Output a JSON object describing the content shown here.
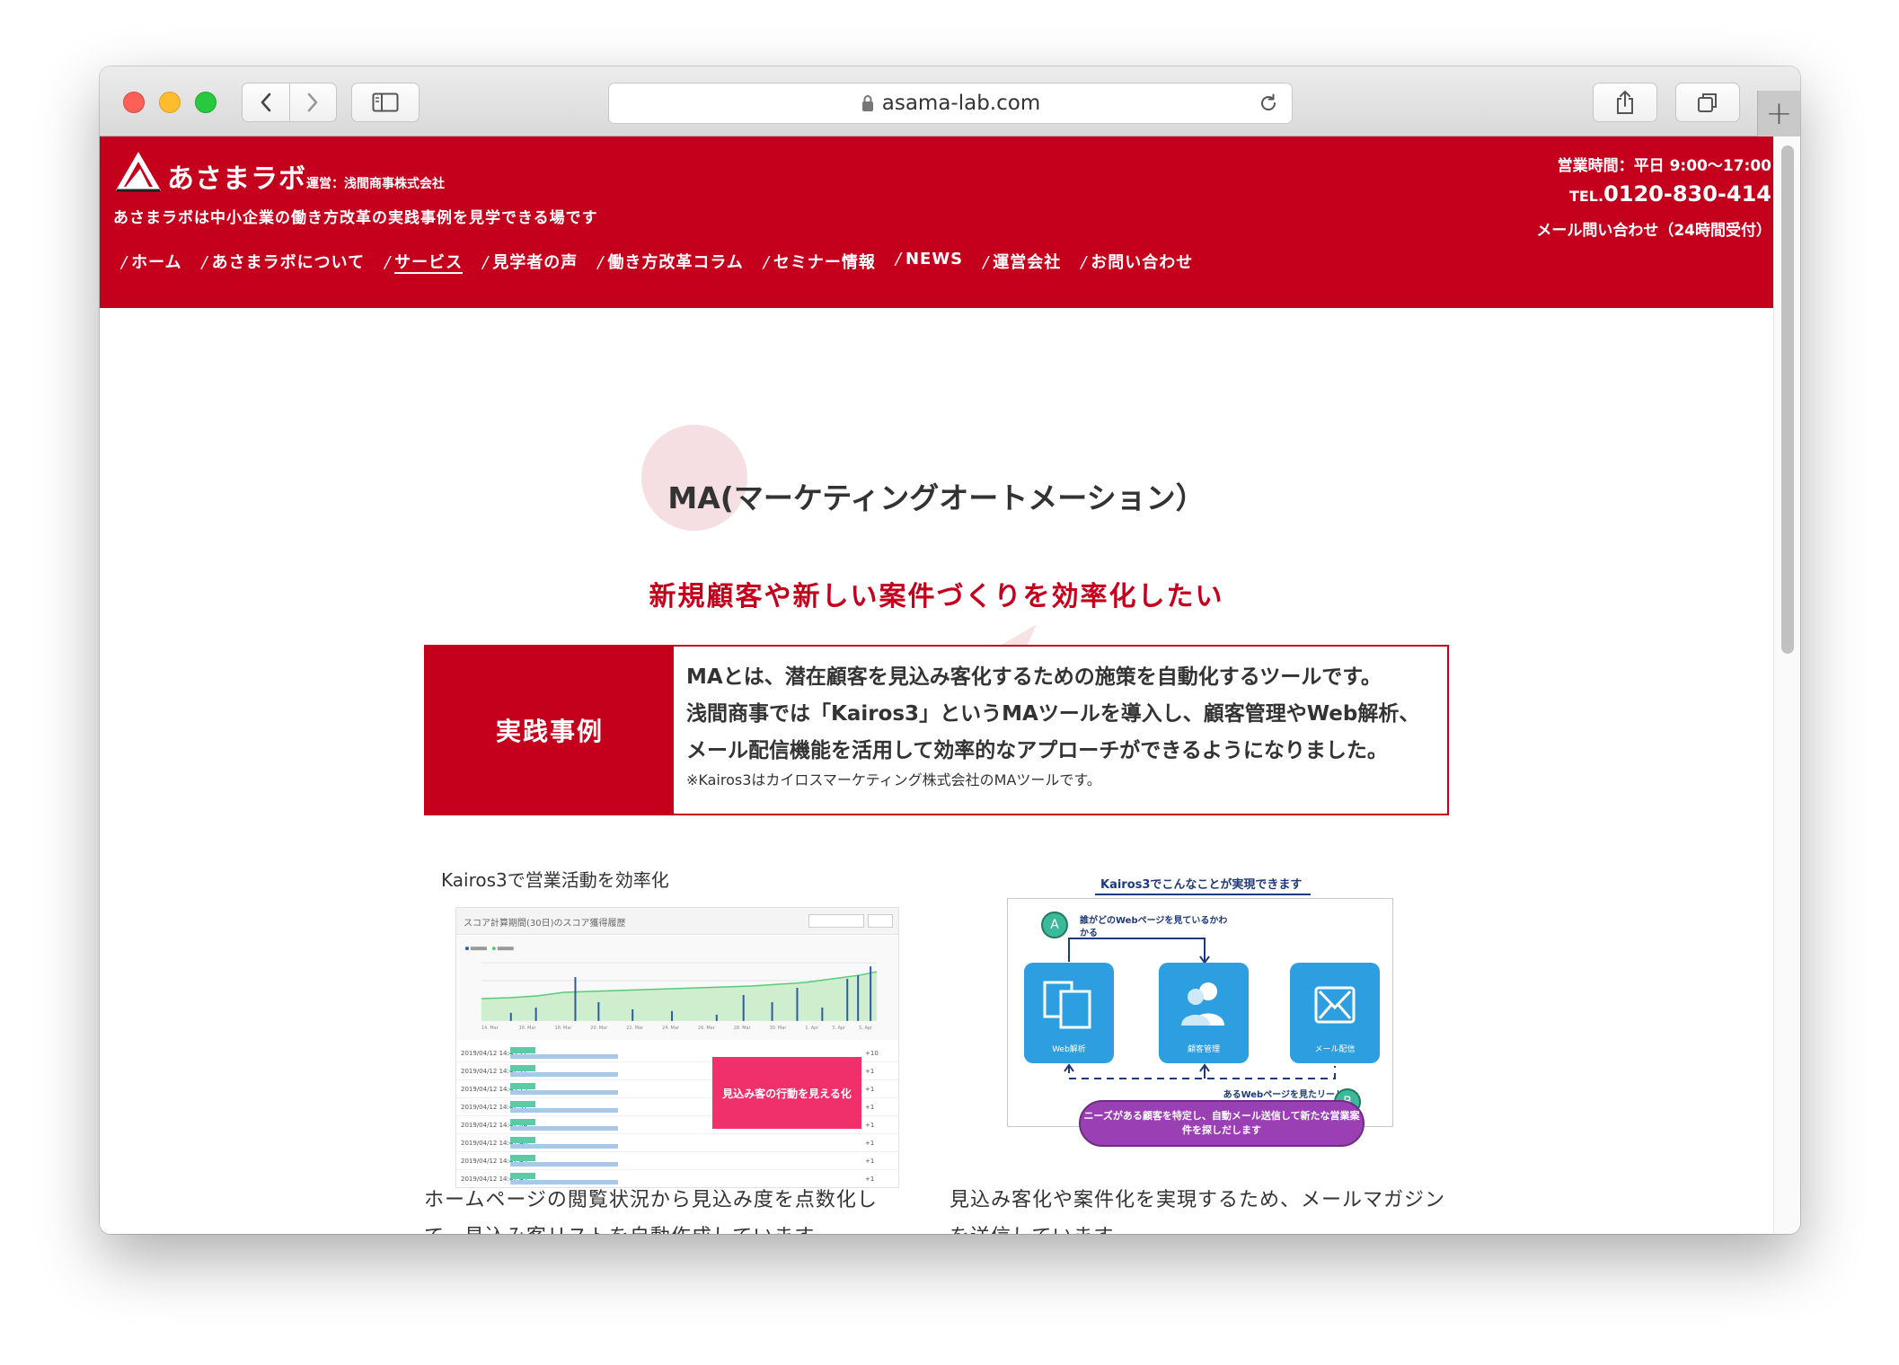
{
  "browser": {
    "url": "asama-lab.com"
  },
  "site": {
    "logo_text": "あさまラボ",
    "logo_sub": "運営：浅間商事株式会社",
    "tagline": "あさまラボは中小企業の働き方改革の実践事例を見学できる場です",
    "hours": "営業時間：平日 9:00〜17:00",
    "tel_prefix": "TEL.",
    "tel_number": "0120-830-414",
    "mail_contact": "メール問い合わせ（24時間受付）",
    "nav": [
      {
        "label": "ホーム"
      },
      {
        "label": "あさまラボについて"
      },
      {
        "label": "サービス"
      },
      {
        "label": "見学者の声"
      },
      {
        "label": "働き方改革コラム"
      },
      {
        "label": "セミナー情報"
      },
      {
        "label": "NEWS"
      },
      {
        "label": "運営会社"
      },
      {
        "label": "お問い合わせ"
      }
    ],
    "nav_active_index": 2,
    "brand_color": "#c4001d"
  },
  "page": {
    "title": "MA(マーケティングオートメーション）",
    "subtitle": "新規顧客や新しい案件づくりを効率化したい",
    "case": {
      "label": "実践事例",
      "lines": [
        "MAとは、潜在顧客を見込み客化するための施策を自動化するツールです。",
        "浅間商事では「Kairos3」というMAツールを導入し、顧客管理やWeb解析、",
        "メール配信機能を活用して効率的なアプローチができるようになりました。"
      ],
      "note": "※Kairos3はカイロスマーケティング株式会社のMAツールです。"
    },
    "left_figure": {
      "caption": "Kairos3で営業活動を効率化",
      "screenshot_title": "スコア計算期間(30日)のスコア獲得履歴",
      "overlay_text": "見込み客の行動を見える化",
      "row_times": [
        "2019/04/12 14:43:17",
        "2019/04/12 14:42:17",
        "2019/04/12 14:43:15",
        "2019/04/12 14:42:31",
        "2019/04/12 14:42:04",
        "2019/04/12 14:41:46",
        "2019/04/12 14:41:45",
        "2019/04/12 14:41:45"
      ],
      "row_points": [
        "+10",
        "+1",
        "+1",
        "+1",
        "+1",
        "+1",
        "+1",
        "+1"
      ],
      "description": "ホームページの閲覧状況から見込み度を点数化して、見込み客リストを自動作成しています。"
    },
    "right_figure": {
      "title": "Kairos3でこんなことが実現できます",
      "badge_a": "A",
      "badge_b": "B",
      "note_a": "誰がどのWebページを見ているかわかる",
      "note_b": "あるWebページを見たリードに接触",
      "tiles": [
        {
          "label": "Web解析",
          "icon": "documents-icon"
        },
        {
          "label": "顧客管理",
          "icon": "people-icon"
        },
        {
          "label": "メール配信",
          "icon": "mail-icon"
        }
      ],
      "pill_text": "ニーズがある顧客を特定し、自動メール送信して新たな営業案件を探しだします",
      "description": "見込み客化や案件化を実現するため、メールマガジンを送信しています。"
    }
  }
}
